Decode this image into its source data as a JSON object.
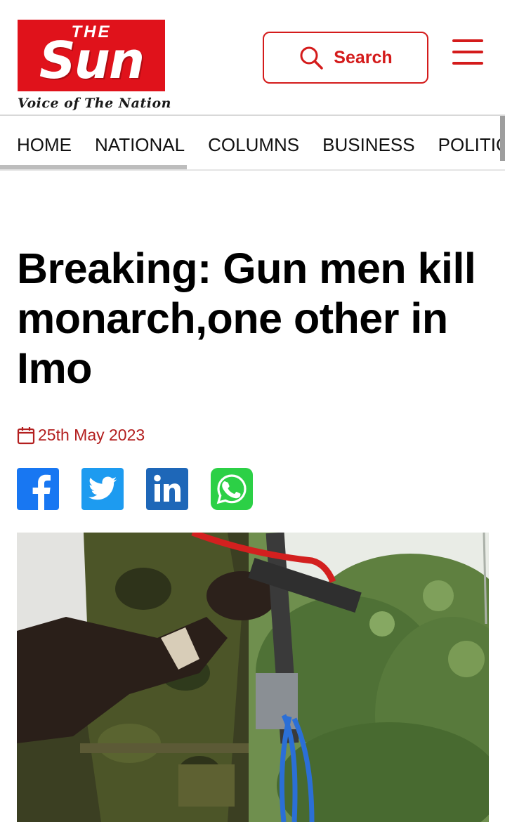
{
  "header": {
    "logo": {
      "the": "THE",
      "sun": "Sun",
      "tagline": "Voice of The Nation"
    },
    "search_label": "Search",
    "menu_icon": "hamburger-menu-icon"
  },
  "nav": {
    "items": [
      {
        "label": "HOME"
      },
      {
        "label": "NATIONAL"
      },
      {
        "label": "COLUMNS"
      },
      {
        "label": "BUSINESS"
      },
      {
        "label": "POLITICS"
      }
    ]
  },
  "article": {
    "headline": "Breaking: Gun men kill monarch,one other in Imo",
    "date": "25th May 2023",
    "date_icon": "calendar-icon",
    "share": [
      {
        "name": "facebook",
        "icon": "facebook-icon",
        "color": "#1877f2"
      },
      {
        "name": "twitter",
        "icon": "twitter-icon",
        "color": "#1d9bf0"
      },
      {
        "name": "linkedin",
        "icon": "linkedin-icon",
        "color": "#1e67b8"
      },
      {
        "name": "whatsapp",
        "icon": "whatsapp-icon",
        "color": "#2cd046"
      }
    ]
  },
  "colors": {
    "brand_red": "#e0121b",
    "accent_red": "#d41b1b",
    "date_red": "#b31f1f"
  }
}
